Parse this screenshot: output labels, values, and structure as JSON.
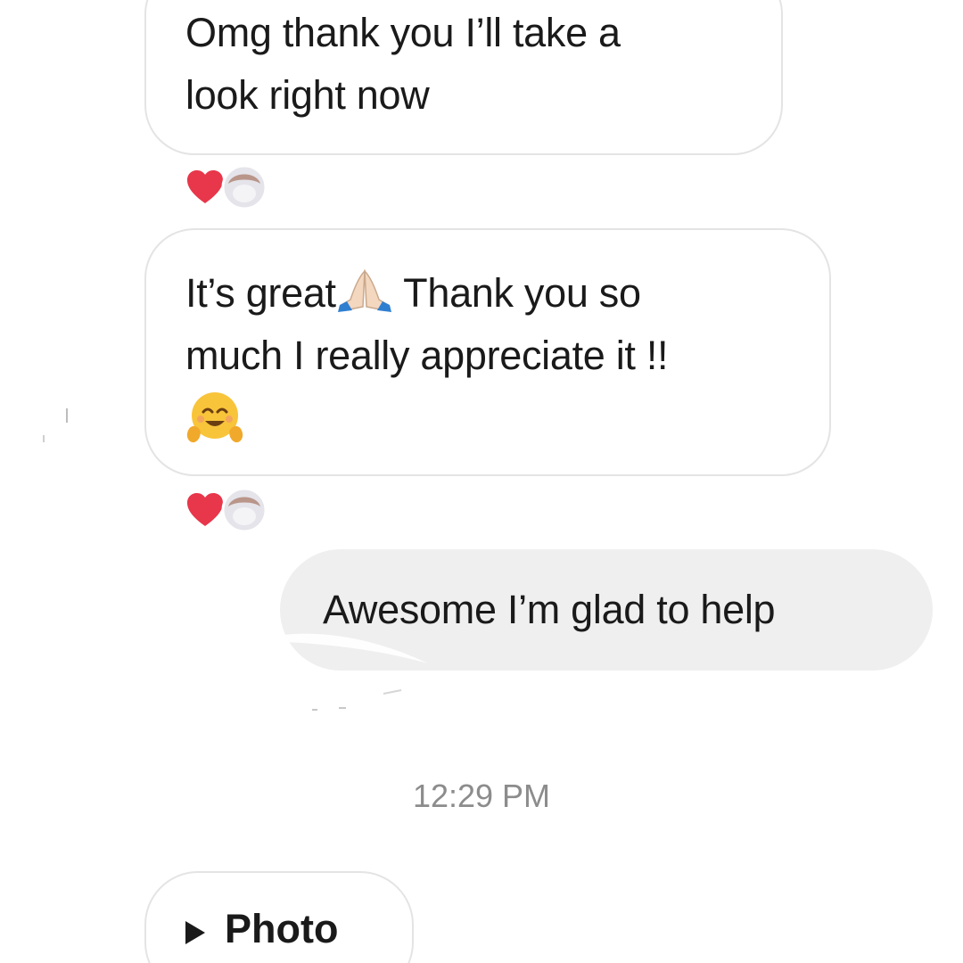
{
  "messages": [
    {
      "direction": "incoming",
      "line1": "Omg thank you I’ll take a",
      "line2": "look right now",
      "reactions": {
        "icon": "heart-icon",
        "color": "#e8364a"
      }
    },
    {
      "direction": "incoming",
      "part1": "It’s great",
      "emoji1": "folded-hands-emoji",
      "part2": " Thank you so",
      "line2": "much I really appreciate it !!",
      "emoji2": "hugging-face-emoji",
      "reactions": {
        "icon": "heart-icon",
        "color": "#e8364a"
      }
    },
    {
      "direction": "outgoing",
      "text": "Awesome I’m glad to help"
    }
  ],
  "timestamp": "12:29 PM",
  "attachment": {
    "icon": "play-icon",
    "label": "Photo"
  },
  "colors": {
    "incoming_bubble": "#ffffff",
    "incoming_border": "#e4e4e4",
    "outgoing_bubble": "#efefef",
    "timestamp": "#8c8c8c",
    "heart": "#e8364a"
  }
}
